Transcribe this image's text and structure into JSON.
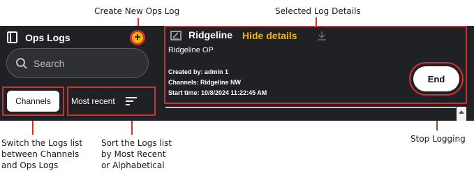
{
  "callouts": {
    "create_new": "Create New Ops Log",
    "selected_details": "Selected Log Details",
    "switch_lines": [
      "Switch the Logs list",
      "between Channels",
      "and Ops Logs"
    ],
    "sort_lines": [
      "Sort the Logs list",
      "by Most Recent",
      "or Alphabetical"
    ],
    "stop": "Stop Logging"
  },
  "sidebar": {
    "title": "Ops Logs",
    "title_icon": "book-icon",
    "add_icon": "plus-icon",
    "search_placeholder": "Search",
    "channels_label": "Channels",
    "sort_label": "Most recent",
    "sort_icon": "sort-lines-icon"
  },
  "detail": {
    "name": "Ridgeline",
    "hide_label": "Hide details",
    "op_name": "Ridgeline OP",
    "created_by": "Created by: admin 1",
    "channels": "Channels: Ridgeline NW",
    "start_time": "Start time: 10/8/2024 11:22:45 AM",
    "end_label": "End"
  },
  "colors": {
    "app_bg": "#202124",
    "accent": "#f5b400",
    "annotation": "#d32f2f"
  }
}
